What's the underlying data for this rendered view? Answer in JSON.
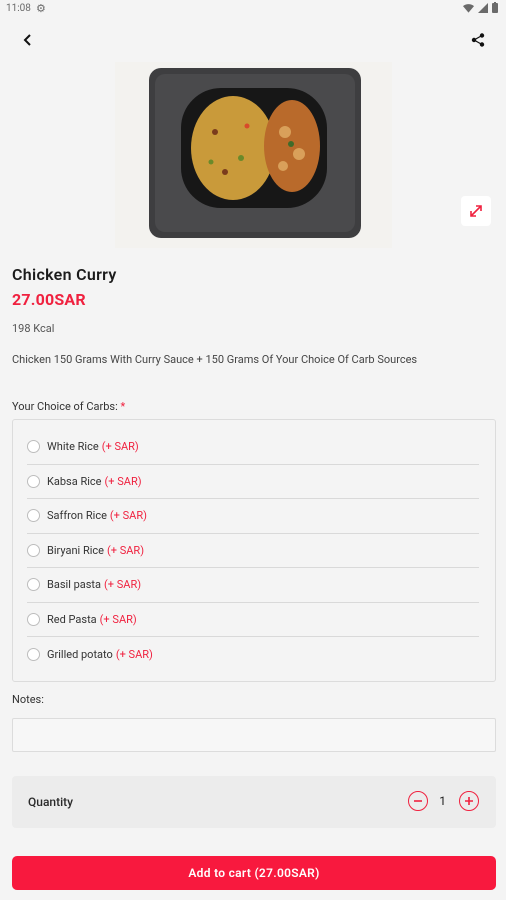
{
  "status_bar": {
    "time": "11:08"
  },
  "product": {
    "title": "Chicken Curry",
    "price": "27.00SAR",
    "kcal": "198 Kcal",
    "description": "Chicken 150 Grams With Curry Sauce + 150 Grams Of Your Choice Of Carb Sources"
  },
  "carbs": {
    "label": "Your Choice of Carbs:",
    "required_mark": "*",
    "options": [
      {
        "name": "White  Rice",
        "price": "(+ SAR)"
      },
      {
        "name": "Kabsa  Rice",
        "price": "(+ SAR)"
      },
      {
        "name": "Saffron Rice",
        "price": "(+ SAR)"
      },
      {
        "name": "Biryani Rice",
        "price": "(+ SAR)"
      },
      {
        "name": "Basil pasta",
        "price": "(+ SAR)"
      },
      {
        "name": "Red Pasta",
        "price": "(+ SAR)"
      },
      {
        "name": "Grilled potato",
        "price": "(+ SAR)"
      }
    ]
  },
  "notes": {
    "label": "Notes:",
    "value": ""
  },
  "quantity": {
    "label": "Quantity",
    "value": "1",
    "minus_icon": "minus-circle-icon",
    "plus_icon": "plus-circle-icon"
  },
  "cart_button": {
    "label": "Add to cart (27.00SAR)"
  },
  "colors": {
    "accent": "#f0213f",
    "button": "#f8193e",
    "background": "#f4f4f4"
  }
}
